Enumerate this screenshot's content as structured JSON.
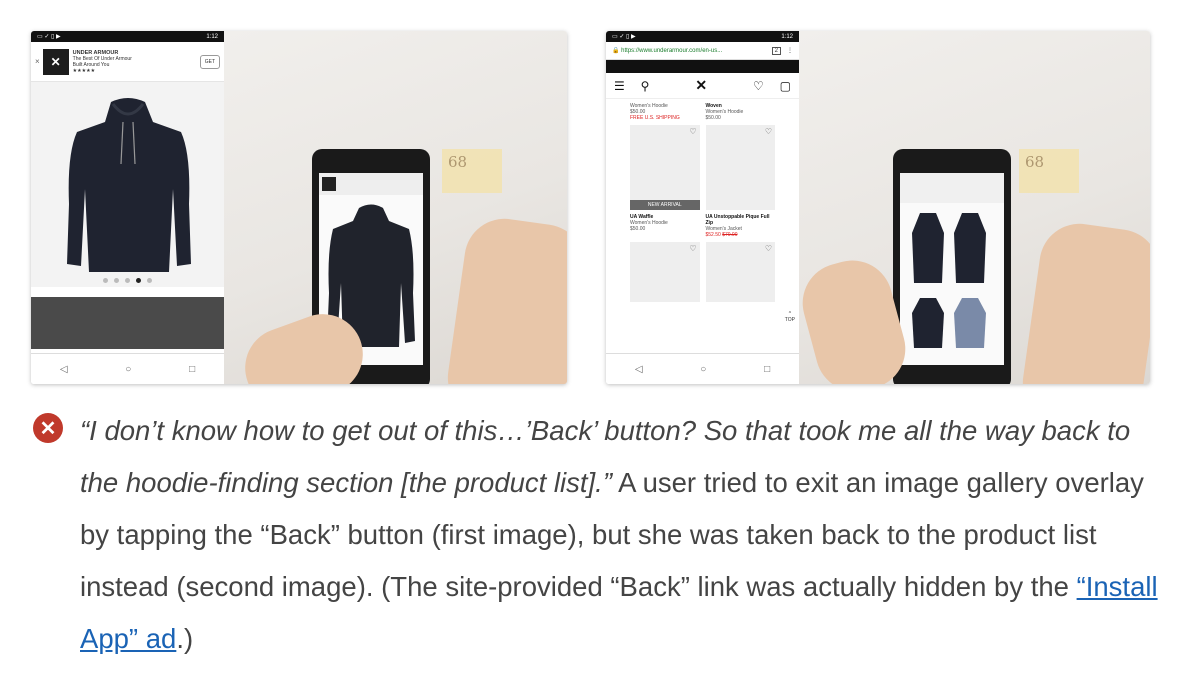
{
  "figures": {
    "first": {
      "status_time": "1:12",
      "ad": {
        "close": "×",
        "brand": "UNDER ARMOUR",
        "tagline": "The Best Of Under Armour",
        "tagline2": "Built Around You",
        "stars": "★★★★★",
        "get_label": "GET"
      },
      "note_number": "68"
    },
    "second": {
      "status_time": "1:12",
      "url": "https://www.underarmour.com/en-us...",
      "tab_count": "2",
      "products_top": [
        {
          "name": "Women's Hoodie",
          "price": "$50.00"
        },
        {
          "name": "Woven",
          "subtitle": "Women's Hoodie",
          "price": "$50.00"
        }
      ],
      "shipping": "FREE U.S. SHIPPING",
      "new_arrival": "NEW ARRIVAL",
      "products_mid": [
        {
          "name": "UA Waffle",
          "subtitle": "Women's Hoodie",
          "price": "$50.00"
        },
        {
          "name": "UA Unstoppable Pique Full Zip",
          "subtitle": "Women's Jacket",
          "price": "$52.50",
          "old_price": "$70.00"
        }
      ],
      "top_label": "TOP",
      "note_number": "68"
    }
  },
  "caption": {
    "quote": "“I don’t know how to get out of this…’Back’ button? So that took me all the way back to the hoodie-finding section [the product list].”",
    "text": " A user tried to exit an image gallery overlay by tapping the “Back” button (first image), but she was taken back to the product list instead (second image). (The site-provided “Back” link was actually hidden by the ",
    "link": "“Install App” ad",
    "end": ".)"
  },
  "icons": {
    "error": "error-x-icon"
  }
}
